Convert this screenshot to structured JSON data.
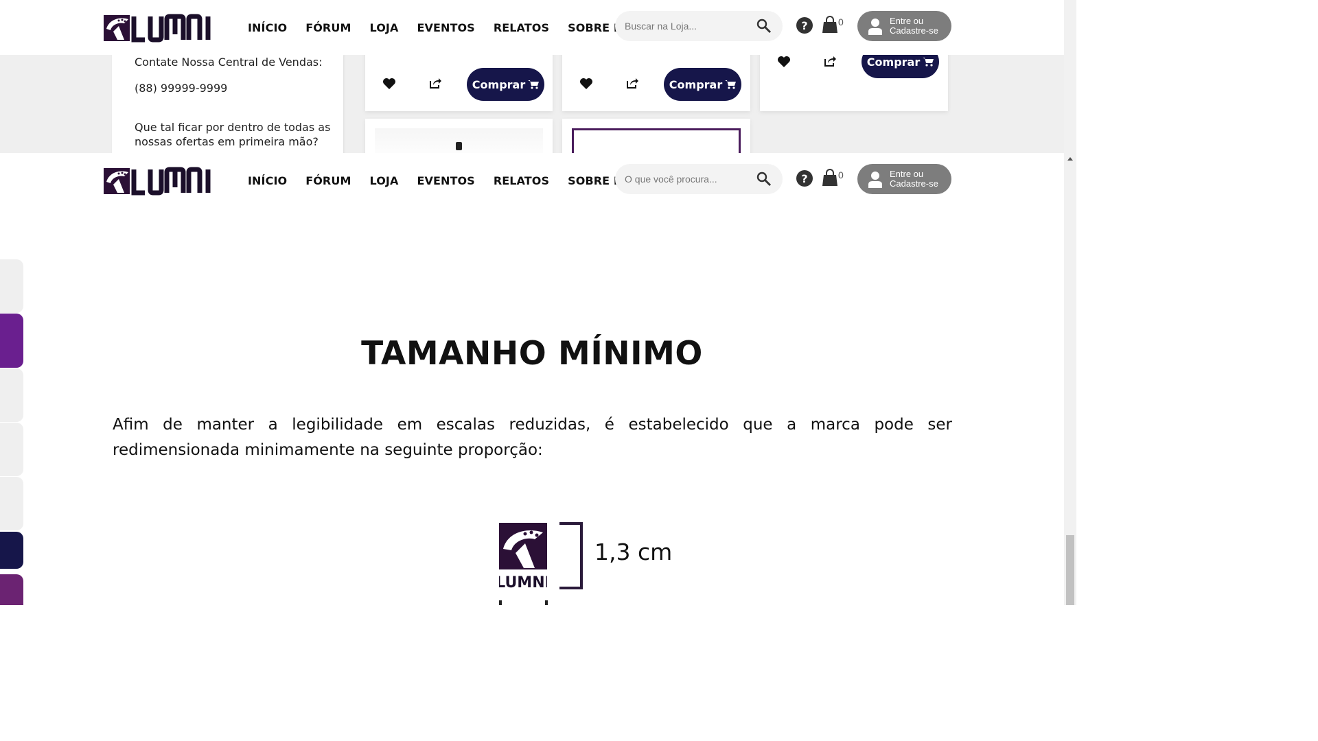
{
  "header": {
    "brand": "LUMNI",
    "nav": [
      "INÍCIO",
      "FÓRUM",
      "LOJA",
      "EVENTOS",
      "RELATOS",
      "SOBRE NÓS"
    ],
    "search_placeholder_top": "Buscar na Loja...",
    "search_placeholder_bottom": "O que você procura...",
    "cart_count": "0",
    "login_label": "Entre ou\nCadastre-se"
  },
  "sidebar": {
    "contact_label": "Contate Nossa Central de Vendas:",
    "phone": "(88) 99999-9999",
    "newsletter_line1": "Que tal ficar por dentro de todas as",
    "newsletter_line2": "nossas ofertas em primeira mão?"
  },
  "products": {
    "buy_label": "Comprar"
  },
  "content": {
    "title": "TAMANHO MÍNIMO",
    "paragraph": "Afim de manter a legibilidade em escalas reduzidas, é estabelecido que a marca pode ser redimensionada minimamente na seguinte proporção:",
    "min_size_label": "1,3 cm",
    "logo_caption": "LUMNI"
  },
  "colors": {
    "brand_purple": "#6a1f8f",
    "brand_navy": "#16164a",
    "side_tab_light": "#efefef",
    "side_tab_magenta": "#6b2372"
  }
}
